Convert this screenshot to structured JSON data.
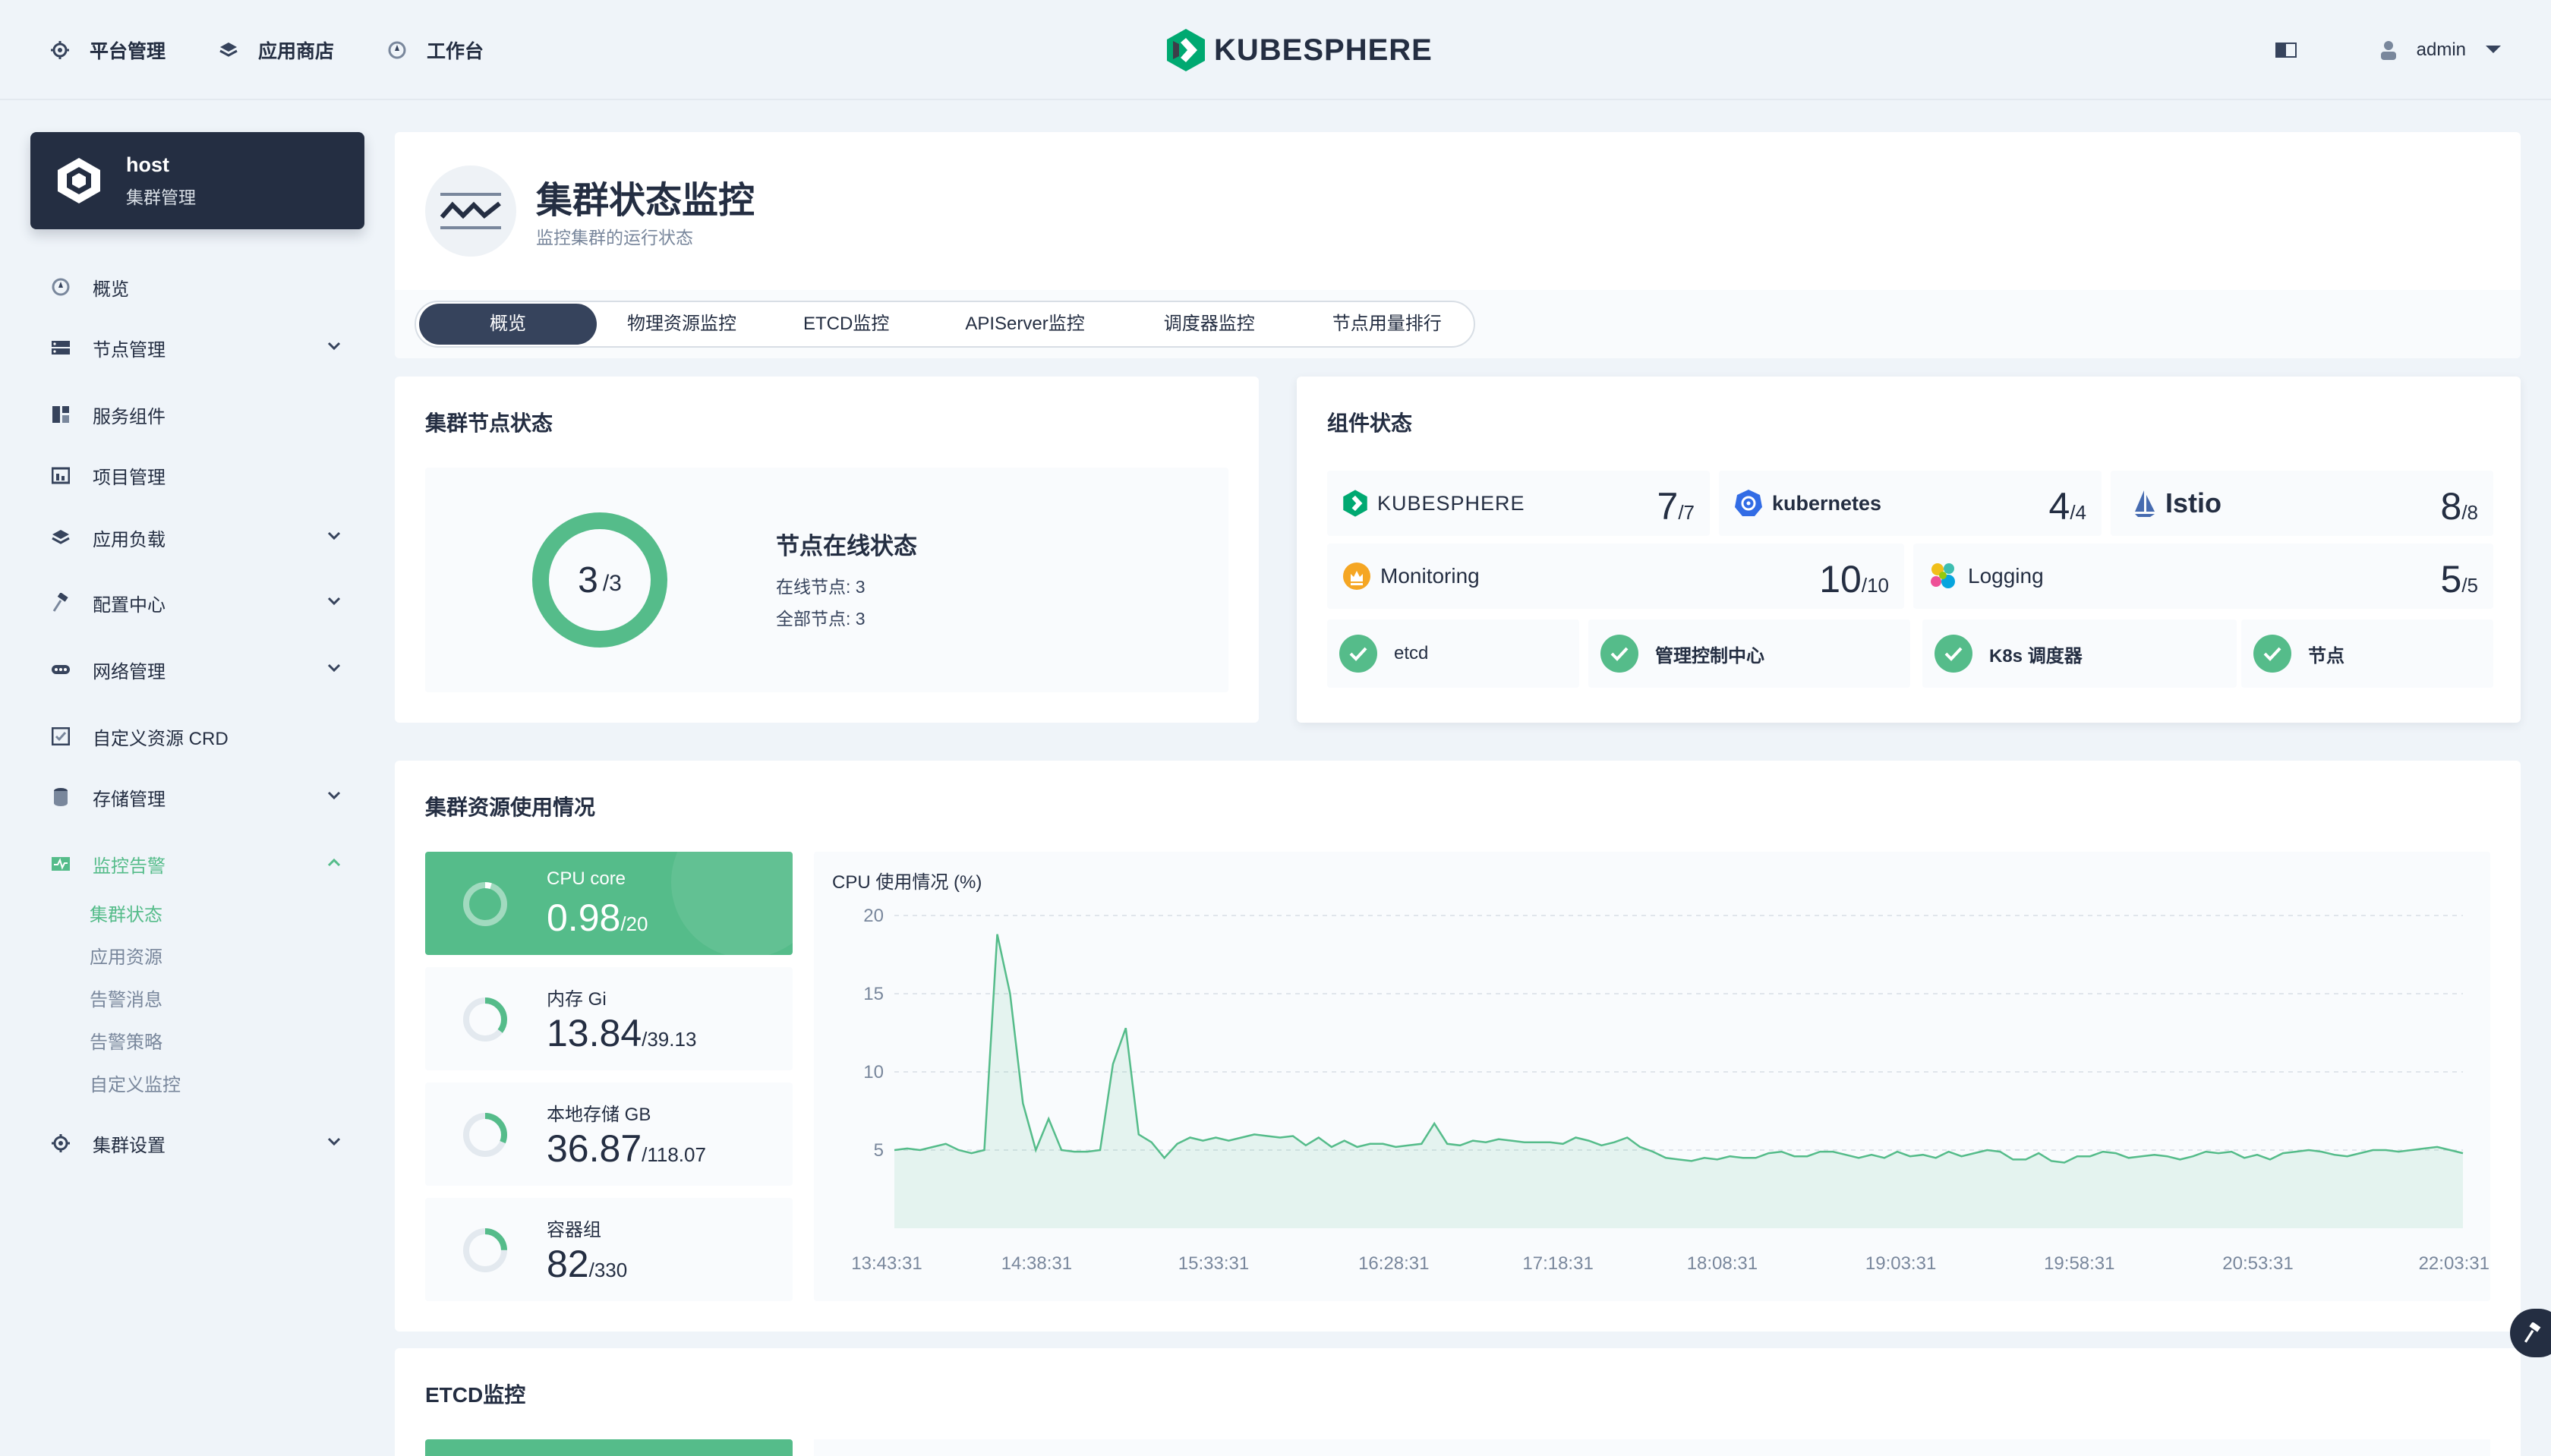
{
  "header": {
    "nav": [
      {
        "label": "平台管理",
        "icon": "gear-icon"
      },
      {
        "label": "应用商店",
        "icon": "stack-icon"
      },
      {
        "label": "工作台",
        "icon": "compass-icon"
      }
    ],
    "logo_text": "KUBESPHERE",
    "user": "admin"
  },
  "cluster": {
    "name": "host",
    "sub": "集群管理"
  },
  "sidebar": {
    "items": [
      {
        "label": "概览",
        "icon": "dashboard-icon",
        "expand": false
      },
      {
        "label": "节点管理",
        "icon": "nodes-icon",
        "expand": true
      },
      {
        "label": "服务组件",
        "icon": "components-icon",
        "expand": false
      },
      {
        "label": "项目管理",
        "icon": "project-icon",
        "expand": false
      },
      {
        "label": "应用负载",
        "icon": "workload-icon",
        "expand": true
      },
      {
        "label": "配置中心",
        "icon": "hammer-icon",
        "expand": true
      },
      {
        "label": "网络管理",
        "icon": "network-icon",
        "expand": true
      },
      {
        "label": "自定义资源 CRD",
        "icon": "crd-icon",
        "expand": false
      },
      {
        "label": "存储管理",
        "icon": "storage-icon",
        "expand": true
      },
      {
        "label": "监控告警",
        "icon": "monitor-icon",
        "expand": true
      },
      {
        "label": "集群设置",
        "icon": "gear-icon",
        "expand": true
      }
    ],
    "subitems": [
      "集群状态",
      "应用资源",
      "告警消息",
      "告警策略",
      "自定义监控"
    ]
  },
  "page": {
    "title": "集群状态监控",
    "subtitle": "监控集群的运行状态"
  },
  "tabs": [
    "概览",
    "物理资源监控",
    "ETCD监控",
    "APIServer监控",
    "调度器监控",
    "节点用量排行"
  ],
  "node_status": {
    "title": "集群节点状态",
    "online": "3",
    "total": "3",
    "heading": "节点在线状态",
    "online_line": "在线节点: 3",
    "total_line": "全部节点: 3"
  },
  "components": {
    "title": "组件状态",
    "items": [
      {
        "name": "KUBESPHERE",
        "count": "7",
        "of": "/7"
      },
      {
        "name": "kubernetes",
        "count": "4",
        "of": "/4"
      },
      {
        "name": "Istio",
        "count": "8",
        "of": "/8"
      },
      {
        "name": "Monitoring",
        "count": "10",
        "of": "/10"
      },
      {
        "name": "Logging",
        "count": "5",
        "of": "/5"
      }
    ],
    "checks": [
      "etcd",
      "管理控制中心",
      "K8s 调度器",
      "节点"
    ]
  },
  "resource": {
    "title": "集群资源使用情况",
    "tiles": [
      {
        "label": "CPU core",
        "value": "0.98",
        "of": "/20",
        "ratio": 0.049
      },
      {
        "label": "内存 Gi",
        "value": "13.84",
        "of": "/39.13",
        "ratio": 0.354
      },
      {
        "label": "本地存储 GB",
        "value": "36.87",
        "of": "/118.07",
        "ratio": 0.312
      },
      {
        "label": "容器组",
        "value": "82",
        "of": "/330",
        "ratio": 0.248
      }
    ]
  },
  "chart_data": {
    "type": "area",
    "title": "CPU 使用情况 (%)",
    "ylim": [
      0,
      20
    ],
    "yticks": [
      5,
      10,
      15,
      20
    ],
    "xticks": [
      "13:43:31",
      "14:38:31",
      "15:33:31",
      "16:28:31",
      "17:18:31",
      "18:08:31",
      "19:03:31",
      "19:58:31",
      "20:53:31",
      "22:03:31"
    ],
    "series": [
      {
        "values": [
          5.0,
          5.1,
          5.0,
          5.2,
          5.4,
          5.0,
          4.8,
          5.0,
          18.8,
          15.0,
          8.0,
          5.0,
          7.0,
          5.0,
          4.9,
          4.9,
          5.0,
          10.5,
          12.8,
          6.0,
          5.5,
          4.5,
          5.4,
          5.8,
          5.6,
          5.8,
          5.6,
          5.8,
          6.0,
          5.9,
          5.8,
          5.9,
          5.3,
          5.8,
          5.2,
          5.6,
          5.2,
          5.4,
          5.4,
          5.2,
          5.3,
          5.4,
          6.7,
          5.4,
          5.3,
          5.6,
          5.5,
          5.7,
          5.6,
          5.5,
          5.5,
          5.5,
          5.4,
          5.8,
          5.6,
          5.3,
          5.5,
          5.8,
          5.2,
          4.9,
          4.5,
          4.4,
          4.3,
          4.5,
          4.4,
          4.6,
          4.5,
          4.5,
          4.8,
          4.9,
          4.6,
          4.6,
          4.9,
          4.9,
          4.7,
          4.5,
          4.7,
          4.5,
          4.9,
          4.6,
          4.7,
          4.5,
          4.9,
          4.6,
          4.8,
          5.0,
          4.9,
          4.4,
          4.4,
          4.8,
          4.3,
          4.2,
          4.6,
          4.6,
          4.9,
          4.8,
          4.5,
          4.6,
          4.7,
          4.6,
          4.4,
          4.6,
          4.9,
          4.8,
          4.9,
          4.5,
          4.7,
          4.4,
          4.8,
          4.9,
          5.0,
          4.9,
          4.7,
          4.6,
          4.8,
          5.0,
          5.0,
          4.9,
          5.0,
          5.1,
          5.2,
          5.0,
          4.8
        ]
      }
    ],
    "color": "#55bc8a"
  },
  "etcd": {
    "title": "ETCD监控"
  },
  "colors": {
    "accent": "#55bc8a",
    "dark": "#242e42",
    "muted": "#79879c"
  }
}
